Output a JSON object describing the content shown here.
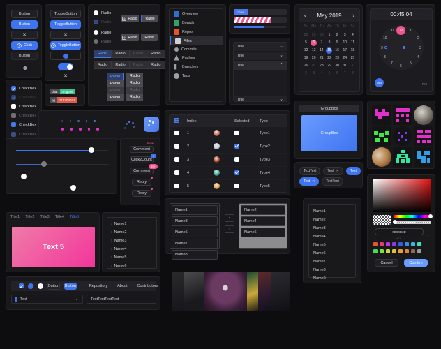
{
  "buttons_panel": {
    "items": [
      {
        "label": "Button",
        "style": "outline"
      },
      {
        "label": "Button",
        "style": "primary"
      },
      {
        "label": "✕",
        "style": "outline"
      },
      {
        "label": "Click",
        "style": "primary-icon"
      },
      {
        "label": "Button",
        "style": "dark"
      },
      {
        "label": "",
        "style": "spinner"
      }
    ]
  },
  "checkbox_panel": {
    "items": [
      {
        "label": "CheckBox",
        "state": "checked"
      },
      {
        "label": "CheckBox",
        "state": "checked-disabled"
      },
      {
        "label": "CheckBox",
        "state": "unchecked"
      },
      {
        "label": "CheckBox",
        "state": "unchecked-disabled"
      },
      {
        "label": "CheckBox",
        "state": "blue"
      },
      {
        "label": "CheckBox",
        "state": "blue-disabled"
      }
    ]
  },
  "toggle_panel": {
    "items": [
      {
        "label": "ToggleButton",
        "style": "outline"
      },
      {
        "label": "ToggleButton",
        "style": "primary"
      },
      {
        "label": "✕",
        "style": "outline"
      },
      {
        "label": "ToggleButton",
        "style": "primary-icon"
      },
      {
        "label": "",
        "style": "switch-off"
      },
      {
        "label": "",
        "style": "switch-on"
      },
      {
        "label": "✕",
        "style": "plain"
      }
    ]
  },
  "badges_panel": {
    "chat": {
      "left": "chat",
      "right": "on gitter",
      "color": "#3ec28f"
    },
    "qq": {
      "left": "qq",
      "right": "714704041",
      "color": "#e05a4a"
    }
  },
  "radio_panel": {
    "rows": [
      {
        "label": "Radio",
        "state": "on"
      },
      {
        "label": "Radio",
        "state": "selected-disabled"
      },
      {
        "label": "Radio",
        "state": "on"
      },
      {
        "label": "Radio",
        "state": "off-disabled"
      }
    ],
    "buttons": [
      {
        "label": "Radio",
        "icon": true
      },
      {
        "label": "Radio",
        "icon": false
      },
      {
        "label": "Radio",
        "icon": true
      },
      {
        "label": "Radio",
        "icon": false
      }
    ],
    "segment_top": [
      {
        "label": "Radio",
        "state": "active"
      },
      {
        "label": "Radio",
        "state": "normal"
      },
      {
        "label": "Radio",
        "state": "disabled"
      },
      {
        "label": "Radio",
        "state": "normal"
      }
    ],
    "segment_bottom": [
      {
        "label": "Radio",
        "state": "normal"
      },
      {
        "label": "Radio",
        "state": "normal"
      },
      {
        "label": "Radio",
        "state": "disabled"
      },
      {
        "label": "Radio",
        "state": "normal"
      }
    ],
    "stack_left": [
      {
        "label": "Radio",
        "state": "active"
      },
      {
        "label": "Radio",
        "state": "normal"
      },
      {
        "label": "Radio",
        "state": "disabled"
      },
      {
        "label": "Radio",
        "state": "normal"
      }
    ],
    "stack_right": [
      {
        "label": "Radio",
        "state": "normal"
      },
      {
        "label": "Radio",
        "state": "normal"
      },
      {
        "label": "Radio",
        "state": "disabled"
      },
      {
        "label": "Radio",
        "state": "normal"
      }
    ]
  },
  "busy_panel": {
    "dot_color_blue": "#4a78e8",
    "dot_color_magenta": "#d536c9"
  },
  "slider_panel": {
    "sliders": [
      {
        "value": 82,
        "track": "#3f74f0",
        "knob": "#ffffff"
      },
      {
        "value": 30,
        "track": "#3f74f0",
        "knob": "#8a8a90"
      },
      {
        "value": 10,
        "track": "#e0543a",
        "knob": "#ffffff",
        "ticks": true
      },
      {
        "value": 60,
        "track": "#3f74f0",
        "knob": "#ffffff",
        "ticks": true
      }
    ]
  },
  "badge_buttons_panel": {
    "items": [
      {
        "label": "Comment",
        "badge": "New",
        "badge_color": "#f2558a",
        "badge_style": "text"
      },
      {
        "label": "Click2Count",
        "badge": "1",
        "badge_color": "#3f74f0",
        "badge_style": "count"
      },
      {
        "label": "Comment",
        "badge": "99+",
        "badge_color": "#f2558a",
        "badge_style": "count"
      },
      {
        "label": "Reply",
        "badge": "",
        "badge_color": "#f2558a",
        "badge_style": "dot"
      },
      {
        "label": "Reply",
        "badge": "",
        "badge_color": "#f2558a",
        "badge_style": "dot"
      }
    ]
  },
  "nav_panel": {
    "items": [
      {
        "label": "Overview",
        "icon": "overview-icon",
        "color": "#2f6fd0",
        "state": "normal"
      },
      {
        "label": "Boards",
        "icon": "boards-icon",
        "color": "#2fa36b",
        "state": "normal"
      },
      {
        "label": "Repos",
        "icon": "repos-icon",
        "color": "#e8542a",
        "state": "normal"
      },
      {
        "label": "Files",
        "icon": "files-icon",
        "color": "#9aa0a8",
        "state": "active"
      },
      {
        "label": "Commits",
        "icon": "commits-icon",
        "color": "#9aa0a8",
        "state": "normal"
      },
      {
        "label": "Pushes",
        "icon": "pushes-icon",
        "color": "#9aa0a8",
        "state": "normal"
      },
      {
        "label": "Branches",
        "icon": "branches-icon",
        "color": "#9aa0a8",
        "state": "normal"
      },
      {
        "label": "Tags",
        "icon": "tags-icon",
        "color": "#9aa0a8",
        "state": "normal"
      }
    ]
  },
  "progress_panel": {
    "bars": [
      {
        "label": "20 %",
        "value": 20,
        "color": "#4a78e8",
        "style": "labeled"
      },
      {
        "label": "",
        "value": 55,
        "color": "#f2558a",
        "style": "striped"
      },
      {
        "label": "",
        "value": 58,
        "color": "#3f74f0",
        "style": "thin"
      }
    ]
  },
  "accordion_panel": {
    "items": [
      {
        "title": "Title",
        "expanded": false
      },
      {
        "title": "Title",
        "expanded": false
      },
      {
        "title": "Title",
        "expanded": true
      },
      {
        "title": "Title",
        "expanded": false
      }
    ],
    "chevron_down": "⌄",
    "chevron_up": "⌃"
  },
  "calendar_panel": {
    "title": "May 2019",
    "prev": "‹",
    "next": "›",
    "weekdays": [
      "Su",
      "Mo",
      "Tu",
      "We",
      "Th",
      "Fr",
      "Sa"
    ],
    "weeks": [
      [
        {
          "d": "28",
          "m": true
        },
        {
          "d": "29",
          "m": true
        },
        {
          "d": "30",
          "m": true
        },
        {
          "d": "1"
        },
        {
          "d": "2"
        },
        {
          "d": "3"
        },
        {
          "d": "4"
        }
      ],
      [
        {
          "d": "5"
        },
        {
          "d": "6",
          "hl": "pink"
        },
        {
          "d": "7"
        },
        {
          "d": "8"
        },
        {
          "d": "9"
        },
        {
          "d": "10"
        },
        {
          "d": "11"
        }
      ],
      [
        {
          "d": "12"
        },
        {
          "d": "13"
        },
        {
          "d": "14"
        },
        {
          "d": "15",
          "hl": "blue"
        },
        {
          "d": "16"
        },
        {
          "d": "17"
        },
        {
          "d": "18"
        }
      ],
      [
        {
          "d": "19"
        },
        {
          "d": "20"
        },
        {
          "d": "21"
        },
        {
          "d": "22"
        },
        {
          "d": "23"
        },
        {
          "d": "24"
        },
        {
          "d": "25"
        }
      ],
      [
        {
          "d": "26"
        },
        {
          "d": "27"
        },
        {
          "d": "28"
        },
        {
          "d": "29"
        },
        {
          "d": "30"
        },
        {
          "d": "31"
        },
        {
          "d": "1",
          "m": true
        }
      ],
      [
        {
          "d": "2",
          "m": true
        },
        {
          "d": "3",
          "m": true
        },
        {
          "d": "4",
          "m": true
        },
        {
          "d": "5",
          "m": true
        },
        {
          "d": "6",
          "m": true
        },
        {
          "d": "7",
          "m": true
        },
        {
          "d": "8",
          "m": true
        }
      ]
    ]
  },
  "clock_panel": {
    "time": "00:45:04",
    "selected_hour": "12",
    "am_label": "Am",
    "pm_label": "Pm",
    "hours": [
      "12",
      "1",
      "2",
      "3",
      "4",
      "5",
      "6",
      "7",
      "8",
      "9",
      "10",
      "11"
    ]
  },
  "table_panel": {
    "columns": [
      "",
      "Index",
      "",
      "Selected",
      "Type"
    ],
    "rows": [
      {
        "index": "1",
        "selected": false,
        "type": "Type1",
        "avatar": "#c8644a"
      },
      {
        "index": "2",
        "selected": true,
        "type": "Type2",
        "avatar": "#b8cbe0"
      },
      {
        "index": "3",
        "selected": false,
        "type": "Type3",
        "avatar": "#a4391f"
      },
      {
        "index": "4",
        "selected": true,
        "type": "Type4",
        "avatar": "#2fa894"
      },
      {
        "index": "5",
        "selected": false,
        "type": "Type5",
        "avatar": "#e0a13a"
      }
    ]
  },
  "groupbox_panel": {
    "header": "GroupBox",
    "body_label": "GroupBox",
    "gradient_from": "#6a9bff",
    "gradient_to": "#3f74f0"
  },
  "chips_panel": {
    "items": [
      {
        "label": "TextText",
        "style": "plain",
        "close": false
      },
      {
        "label": "Text",
        "style": "plain",
        "close": true
      },
      {
        "label": "Text",
        "style": "blue",
        "close": false
      },
      {
        "label": "Text",
        "style": "blue",
        "close": true
      },
      {
        "label": "TextText",
        "style": "plain",
        "close": false
      }
    ]
  },
  "avatars_panel": {
    "tiles": [
      {
        "type": "pixel",
        "color": "#e030c8",
        "name": "identicon-heart"
      },
      {
        "type": "pixel",
        "color": "#e030c8",
        "name": "identicon-blocks"
      },
      {
        "type": "photo",
        "color": "#8a8a86",
        "name": "photo-avatar-1"
      },
      {
        "type": "pixel",
        "color": "#3ce84a",
        "name": "identicon-creeper"
      },
      {
        "type": "pixel-round",
        "color": "#7c3cf0",
        "name": "identicon-dots"
      },
      {
        "type": "pixel",
        "color": "#e030c8",
        "name": "identicon-bars"
      },
      {
        "type": "photo-round",
        "color": "#c07a4a",
        "name": "photo-avatar-2"
      },
      {
        "type": "pixel",
        "color": "#2fe8a0",
        "name": "identicon-invader"
      },
      {
        "type": "pixel",
        "color": "#2f9fe8",
        "name": "identicon-glyph"
      }
    ]
  },
  "transfer_panel": {
    "left": [
      "Name1",
      "Name3",
      "Name5",
      "Name7",
      "Name8"
    ],
    "right": [
      "Name2",
      "Name4",
      "Name6"
    ],
    "btn_left": "‹",
    "btn_right": "›"
  },
  "list_panel": {
    "items": [
      "Name1",
      "Name2",
      "Name3",
      "Name4",
      "Name5",
      "Name6",
      "Name7",
      "Name8",
      "Name9"
    ]
  },
  "tabs_panel": {
    "tabs": [
      {
        "label": "Title1",
        "active": false
      },
      {
        "label": "Title2",
        "active": false
      },
      {
        "label": "Title3",
        "active": false
      },
      {
        "label": "Title4",
        "active": false
      },
      {
        "label": "Title5",
        "active": true
      }
    ],
    "content": "Text 5",
    "gradient_from": "#f07ba8",
    "gradient_to": "#f2359a"
  },
  "tree_panel": {
    "items": [
      "Name1",
      "Name2",
      "Name3",
      "Name4",
      "Name5",
      "Name6"
    ],
    "caret": "›"
  },
  "toolbar_panel": {
    "buttons": [
      {
        "label": "Button",
        "style": "plain"
      },
      {
        "label": "Button",
        "style": "primary"
      }
    ],
    "menu": [
      "Repository",
      "About",
      "Contributors"
    ],
    "dropdown_value": "Text",
    "text_value": "TextTextTextText",
    "chevron": "⌄"
  },
  "color_picker": {
    "hex_value": "#D93D3D",
    "hex_label": "HEX",
    "cancel": "Cancel",
    "confirm": "Confirm",
    "swatches_row1": [
      "#e8543a",
      "#e83a6e",
      "#b83ae0",
      "#8a3ae0",
      "#3a5ae0",
      "#3a8ae0",
      "#3ab8e0",
      "#3ae0c0"
    ],
    "swatches_row2": [
      "#3ae05a",
      "#8ae03a",
      "#c0e03a",
      "#e0c03a",
      "#e0a03a",
      "#e0803a",
      "#8a6a5a",
      "#9a9a9a"
    ]
  },
  "photo_panel": {
    "name": "photo-strip"
  }
}
